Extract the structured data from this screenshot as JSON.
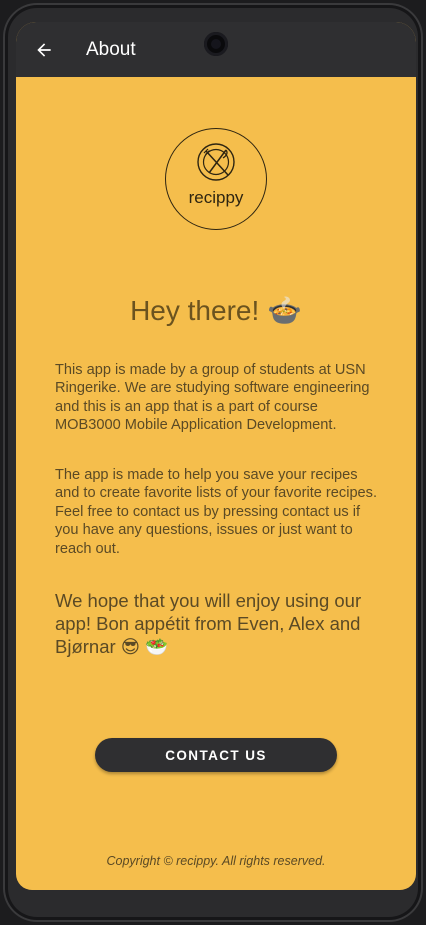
{
  "appbar": {
    "title": "About",
    "back_icon": "arrow-left-icon"
  },
  "logo": {
    "text": "recippy",
    "icon": "plate-fork-knife-icon"
  },
  "content": {
    "greeting": "Hey there! 🍲",
    "paragraph1": "This app is made by a group of students at USN Ringerike. We are studying software engineering and this is an app that is a part of course MOB3000 Mobile Application Development.",
    "paragraph2": "The app is made to help you save your recipes and to create favorite lists of your favorite recipes. Feel free to contact us by pressing contact us if you have any questions, issues or just want to reach out.",
    "closing": "We hope that you will enjoy using our app! Bon appétit from Even, Alex and Bjørnar 😎 🥗"
  },
  "contact_button": {
    "label": "CONTACT US"
  },
  "footer": {
    "copyright": "Copyright © recippy. All rights reserved."
  },
  "colors": {
    "background": "#f5be4c",
    "appbar": "#2f2f31",
    "button": "#2f2f31",
    "text": "#5b4a25"
  }
}
